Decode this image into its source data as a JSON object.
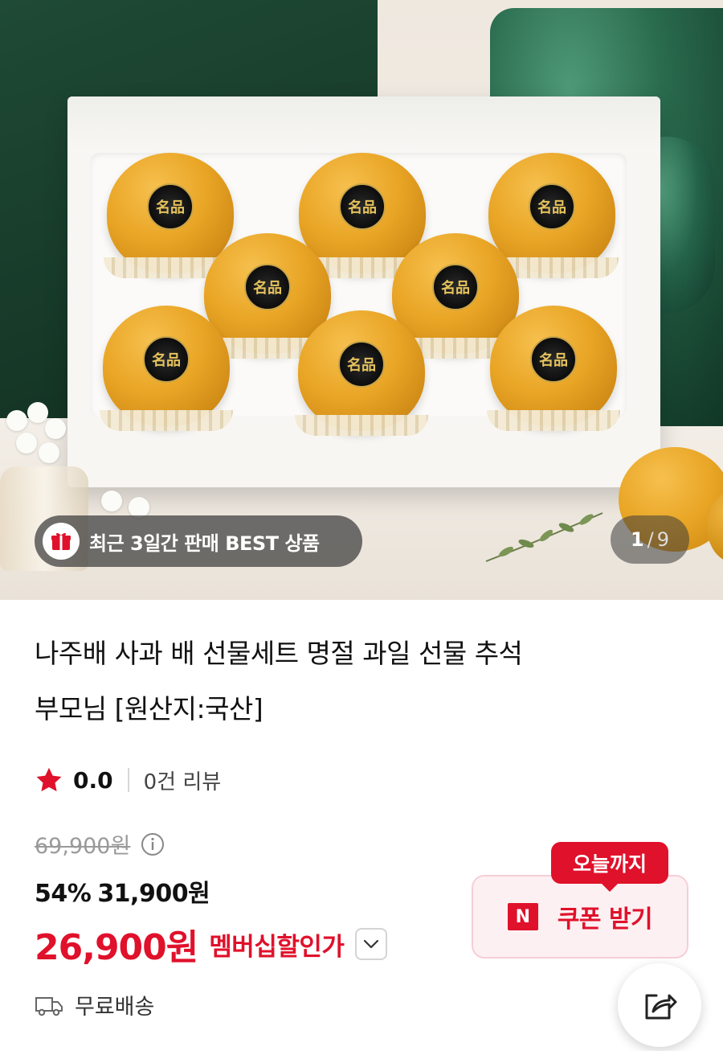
{
  "hero": {
    "badge_label": "최근 3일간 판매 BEST 상품",
    "badge_icon": "gift-box-icon",
    "pager_current": "1",
    "pager_separator": "/",
    "pager_total": "9",
    "seal_text": "名品"
  },
  "product": {
    "title_line1": "나주배 사과 배 선물세트 명절 과일 선물 추석",
    "title_line2": "부모님 [원산지:국산]"
  },
  "rating": {
    "score": "0.0",
    "reviews": "0건 리뷰",
    "star_color": "#e0112b"
  },
  "price": {
    "original": "69,900원",
    "discount_rate": "54%",
    "sale_price": "31,900원",
    "member_price": "26,900원",
    "member_label": "멤버십할인가",
    "accent_color": "#e0112b"
  },
  "coupon": {
    "tag": "오늘까지",
    "logo": "N",
    "label": "쿠폰 받기"
  },
  "shipping": {
    "label": "무료배송",
    "icon": "truck-icon"
  },
  "share": {
    "icon": "share-icon"
  }
}
